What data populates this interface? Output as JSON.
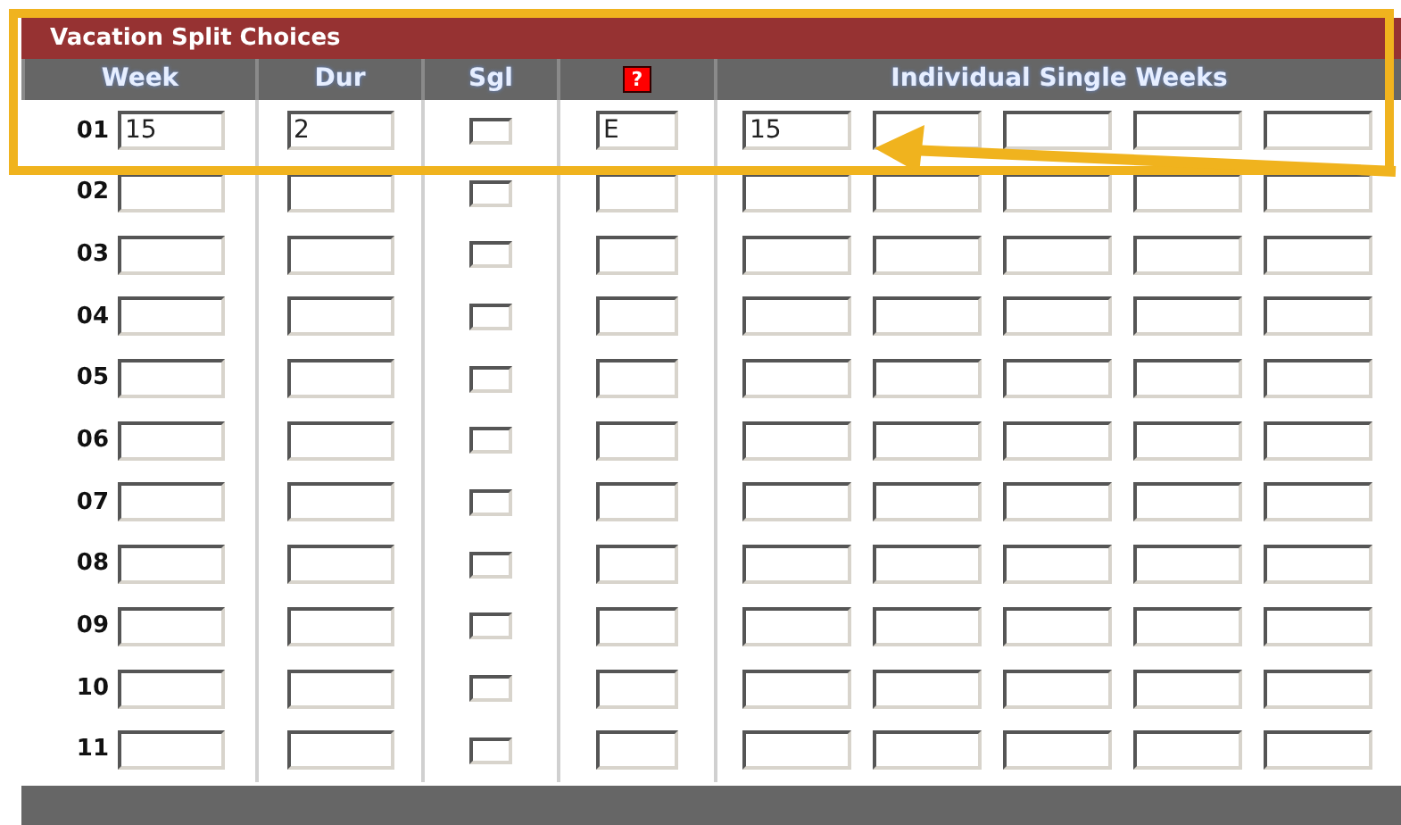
{
  "panel": {
    "title": "Vacation Split Choices"
  },
  "columns": [
    {
      "label": "Week",
      "kind": "text"
    },
    {
      "label": "Dur",
      "kind": "text"
    },
    {
      "label": "Sgl",
      "kind": "text"
    },
    {
      "label": "?",
      "kind": "help"
    },
    {
      "label": "Individual Single Weeks",
      "kind": "text"
    }
  ],
  "rows": [
    {
      "label": "01",
      "week": "15",
      "dur": "2",
      "sgl_checked": false,
      "code": "E",
      "singles": [
        "15"
      ]
    },
    {
      "label": "02",
      "sgl_checked": false
    },
    {
      "label": "03",
      "sgl_checked": false
    },
    {
      "label": "04",
      "sgl_checked": false
    },
    {
      "label": "05",
      "sgl_checked": false
    },
    {
      "label": "06",
      "sgl_checked": false
    },
    {
      "label": "07",
      "sgl_checked": false
    },
    {
      "label": "08",
      "sgl_checked": false
    },
    {
      "label": "09",
      "sgl_checked": false
    },
    {
      "label": "10",
      "sgl_checked": false
    },
    {
      "label": "11",
      "sgl_checked": false
    }
  ]
}
